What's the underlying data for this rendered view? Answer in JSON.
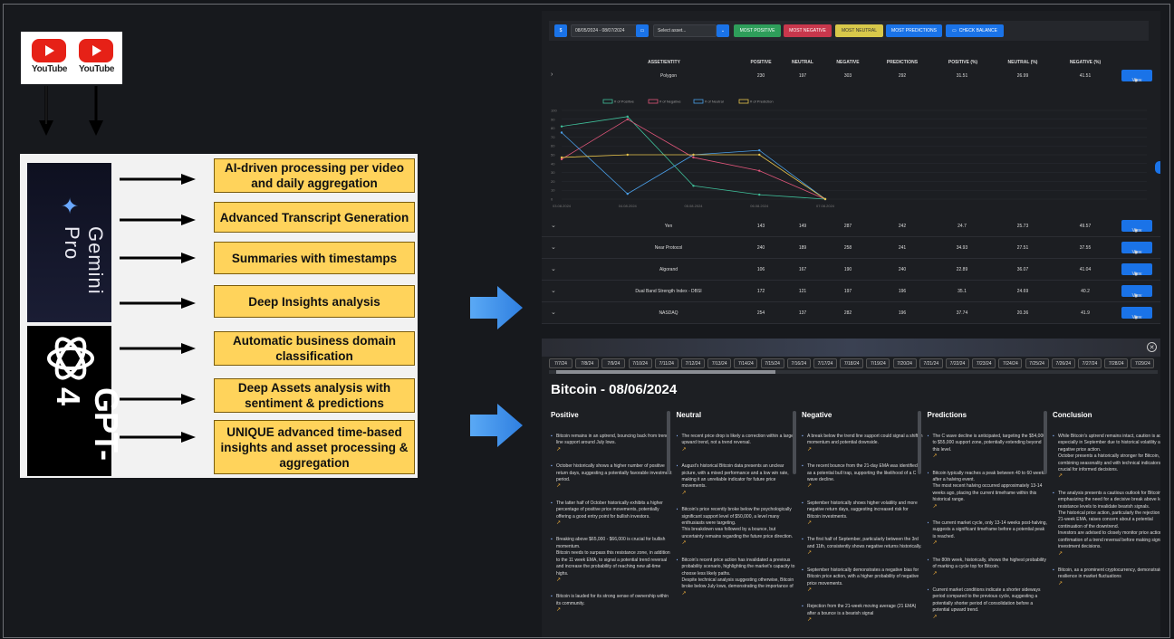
{
  "diagram": {
    "youtube_label": "YouTube",
    "gemini": {
      "name": "Gemini Pro"
    },
    "gpt": {
      "name": "GPT-4"
    },
    "features": [
      "AI-driven processing per video and daily aggregation",
      "Advanced Transcript Generation",
      "Summaries with timestamps",
      "Deep Insights analysis",
      "Automatic business domain classification",
      "Deep Assets analysis with sentiment & predictions",
      "UNIQUE advanced time-based insights and asset processing & aggregation"
    ]
  },
  "dashboard": {
    "toolbar": {
      "currency_btn": "$",
      "date_range": "08/05/2024 - 08/07/2024",
      "asset_placeholder": "Select asset...",
      "most_positive": "MOST POSITIVE",
      "most_negative": "MOST NEGATIVE",
      "most_neutral": "MOST NEUTRAL",
      "most_predictions": "MOST PREDICTIONS",
      "check_balance": "CHECK BALANCE"
    },
    "headers": [
      "ASSET/ENTITY",
      "POSITIVE",
      "NEUTRAL",
      "NEGATIVE",
      "PREDICTIONS",
      "POSITIVE (%)",
      "NEUTRAL (%)",
      "NEGATIVE (%)"
    ],
    "view_label": "View",
    "expanded_row": {
      "asset": "Polygon",
      "positive": "230",
      "neutral": "197",
      "negative": "303",
      "predictions": "292",
      "positive_pct": "31.51",
      "neutral_pct": "26.99",
      "negative_pct": "41.51"
    },
    "rows": [
      {
        "asset": "Yen",
        "positive": "143",
        "neutral": "149",
        "negative": "287",
        "predictions": "242",
        "positive_pct": "24.7",
        "neutral_pct": "25.73",
        "negative_pct": "49.57"
      },
      {
        "asset": "Near Protocol",
        "positive": "240",
        "neutral": "189",
        "negative": "258",
        "predictions": "241",
        "positive_pct": "34.93",
        "neutral_pct": "27.51",
        "negative_pct": "37.55"
      },
      {
        "asset": "Algorand",
        "positive": "106",
        "neutral": "167",
        "negative": "190",
        "predictions": "240",
        "positive_pct": "22.89",
        "neutral_pct": "36.07",
        "negative_pct": "41.04"
      },
      {
        "asset": "Dual Band Strength Index - DBSI",
        "positive": "172",
        "neutral": "121",
        "negative": "197",
        "predictions": "196",
        "positive_pct": "35.1",
        "neutral_pct": "24.69",
        "negative_pct": "40.2"
      },
      {
        "asset": "NASDAQ",
        "positive": "254",
        "neutral": "137",
        "negative": "282",
        "predictions": "196",
        "positive_pct": "37.74",
        "neutral_pct": "20.36",
        "negative_pct": "41.9"
      }
    ],
    "chart_data": {
      "type": "line",
      "x": [
        "03.08.2024",
        "04.08.2024",
        "05.08.2024",
        "06.08.2024",
        "07.08.2024"
      ],
      "series": [
        {
          "name": "# of Positive",
          "color": "#3fbf9a",
          "values": [
            82,
            93,
            15,
            5,
            0
          ]
        },
        {
          "name": "# of Negative",
          "color": "#e0557a",
          "values": [
            45,
            90,
            47,
            32,
            0
          ]
        },
        {
          "name": "# of Neutral",
          "color": "#4a9fe8",
          "values": [
            75,
            6,
            50,
            55,
            0
          ]
        },
        {
          "name": "# of Prediction",
          "color": "#e6c24a",
          "values": [
            47,
            50,
            50,
            50,
            0
          ]
        }
      ],
      "ylim": [
        0,
        100
      ],
      "yticks": [
        "0",
        "10",
        "20",
        "30",
        "40",
        "50",
        "60",
        "70",
        "80",
        "90",
        "100"
      ]
    }
  },
  "modal": {
    "dates": [
      "7/7/24",
      "7/8/24",
      "7/9/24",
      "7/10/24",
      "7/11/24",
      "7/12/24",
      "7/13/24",
      "7/14/24",
      "7/15/24",
      "7/16/24",
      "7/17/24",
      "7/18/24",
      "7/19/24",
      "7/20/24",
      "7/21/24",
      "7/22/24",
      "7/23/24",
      "7/24/24",
      "7/25/24",
      "7/26/24",
      "7/27/24",
      "7/28/24",
      "7/29/24"
    ],
    "title": "Bitcoin - 08/06/2024",
    "columns": [
      {
        "head": "Positive",
        "items": [
          "Bitcoin remains in an uptrend, bouncing back from trend line support around July lows.",
          "October historically shows a higher number of positive return days, suggesting a potentially favorable investment period.",
          "The latter half of October historically exhibits a higher percentage of positive price movements, potentially offering a good entry point for bullish investors.",
          "Breaking above $65,000 - $66,000 is crucial for bullish momentum.\n Bitcoin needs to surpass this resistance zone, in addition to the 11 week EMA, to signal a potential trend reversal and increase the probability of reaching new all-time highs.",
          "Bitcoin is lauded for its strong sense of ownership within its community."
        ]
      },
      {
        "head": "Neutral",
        "items": [
          "The recent price drop is likely a correction within a larger upward trend, not a trend reversal.",
          "August's historical Bitcoin data presents an unclear picture, with a mixed performance and a low win rate, making it an unreliable indicator for future price movements.",
          "Bitcoin's price recently broke below the psychologically significant support level of $50,000, a level many enthusiasts were targeting.\n This breakdown was followed by a bounce, but uncertainty remains regarding the future price direction.",
          "Bitcoin's recent price action has invalidated a previous probability scenario, highlighting the market's capacity to choose less likely paths.\n Despite technical analysis suggesting otherwise, Bitcoin broke below July lows, demonstrating the importance of"
        ]
      },
      {
        "head": "Negative",
        "items": [
          "A break below the trend line support could signal a shift in momentum and potential downside.",
          "The recent bounce from the 21-day EMA was identified as a potential bull trap, supporting the likelihood of a C wave decline.",
          "September historically shows higher volatility and more negative return days, suggesting increased risk for Bitcoin investments.",
          "The first half of September, particularly between the 3rd and 11th, consistently shows negative returns historically.",
          "September historically demonstrates a negative bias for Bitcoin price action, with a higher probability of negative price movements.",
          "Rejection from the 21-week moving average (21 EMA) after a bounce is a bearish signal"
        ]
      },
      {
        "head": "Predictions",
        "items": [
          "The C wave decline is anticipated, targeting the $54,000 to $55,000 support zone, potentially extending beyond this level.",
          "Bitcoin typically reaches a peak between 40 to 60 weeks after a halving event.\n The most recent halving occurred approximately 13-14 weeks ago, placing the current timeframe within this historical range.",
          "The current market cycle, only 13-14 weeks post-halving, suggests a significant timeframe before a potential peak is reached.",
          "The 80th week, historically, shows the highest probability of marking a cycle top for Bitcoin.",
          "Current market conditions indicate a shorter sideways period compared to the previous cycle, suggesting a potentially shorter period of consolidation before a potential upward trend."
        ]
      },
      {
        "head": "Conclusion",
        "items": [
          "While Bitcoin's uptrend remains intact, caution is advised, especially in September due to historical volatility and negative price action.\n October presents a historically stronger for Bitcoin, but combining seasonality and with technical indicators is crucial for informed decisions.",
          "The analysis presents a cautious outlook for Bitcoin, emphasizing the need for a decisive break above key resistance levels to invalidate bearish signals.\n The historical price action, particularly the rejection at the 21-week EMA, raises concern about a potential continuation of the downtrend.\n Investors are advised to closely monitor price action for confirmation of a trend reversal before making significant investment decisions.",
          "Bitcoin, as a prominent cryptocurrency, demonstrates resilience in market fluctuations"
        ]
      }
    ]
  }
}
